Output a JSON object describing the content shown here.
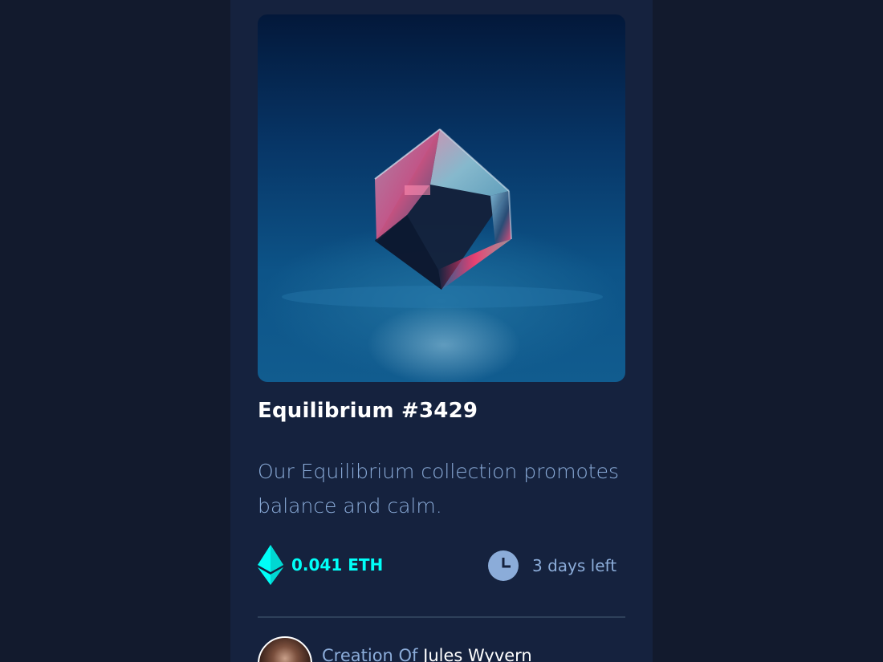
{
  "card": {
    "title": "Equilibrium #3429",
    "description": "Our Equilibrium collection promotes balance and calm.",
    "price": "0.041 ETH",
    "time_left": "3 days left",
    "creator_prefix": "Creation Of ",
    "creator_name": "Jules Wyvern"
  },
  "icons": {
    "price": "ethereum-icon",
    "time": "clock-icon",
    "image": "equilibrium-cube-image"
  },
  "colors": {
    "background": "#121a2d",
    "card": "#15223e",
    "accent": "#00fff8",
    "soft_blue": "#8bacd9",
    "white": "#ffffff"
  }
}
